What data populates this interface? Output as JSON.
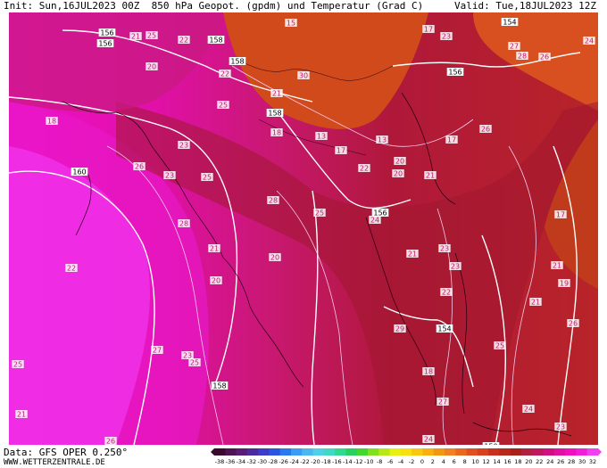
{
  "header": {
    "init": "Init: Sun,16JUL2023 00Z",
    "title": "850 hPa Geopot. (gpdm) und Temperatur (Grad C)",
    "valid": "Valid: Tue,18JUL2023 12Z"
  },
  "footer": {
    "data": "Data: GFS OPER 0.250°",
    "url": "WWW.WETTERZENTRALE.DE"
  },
  "colorbar": {
    "labels": [
      "-38",
      "-36",
      "-34",
      "-32",
      "-30",
      "-28",
      "-26",
      "-24",
      "-22",
      "-20",
      "-18",
      "-16",
      "-14",
      "-12",
      "-10",
      "-8",
      "-6",
      "-4",
      "-2",
      "0",
      "2",
      "4",
      "6",
      "8",
      "10",
      "12",
      "14",
      "16",
      "18",
      "20",
      "22",
      "24",
      "26",
      "28",
      "30",
      "32"
    ],
    "colors": [
      "#3a0a2e",
      "#4c1450",
      "#5a1a78",
      "#4a2aa0",
      "#3c3cc8",
      "#2b55e0",
      "#2a78f0",
      "#3a9cf5",
      "#4ab8f0",
      "#50d0e8",
      "#40d8c0",
      "#30d890",
      "#28d060",
      "#40d830",
      "#80e020",
      "#b8e818",
      "#e8f010",
      "#f8e010",
      "#f8c810",
      "#f8b010",
      "#f09810",
      "#f08020",
      "#e86820",
      "#e05020",
      "#d84020",
      "#c83020",
      "#b82818",
      "#a82018",
      "#b02040",
      "#c01860",
      "#d01080",
      "#e010a0",
      "#f010c0",
      "#f020d8",
      "#f040f0"
    ]
  },
  "map_data": {
    "temperature_labels": [
      "15",
      "17",
      "23",
      "25",
      "22",
      "21",
      "18",
      "20",
      "27",
      "28",
      "26",
      "24",
      "30",
      "25",
      "17",
      "13",
      "20",
      "22",
      "21",
      "28",
      "26",
      "23",
      "25",
      "28",
      "21",
      "20",
      "20",
      "25",
      "24",
      "21",
      "23",
      "29",
      "18",
      "27",
      "24",
      "23",
      "25",
      "27",
      "26",
      "25",
      "21",
      "22",
      "22",
      "23",
      "17",
      "21",
      "19",
      "26",
      "24",
      "23",
      "25",
      "21",
      "26",
      "17",
      "13",
      "18",
      "20",
      "21",
      "22",
      "23"
    ],
    "geopotential_labels": [
      "156",
      "158",
      "154",
      "156",
      "158",
      "158",
      "160",
      "156",
      "156",
      "154",
      "158",
      "150"
    ]
  }
}
